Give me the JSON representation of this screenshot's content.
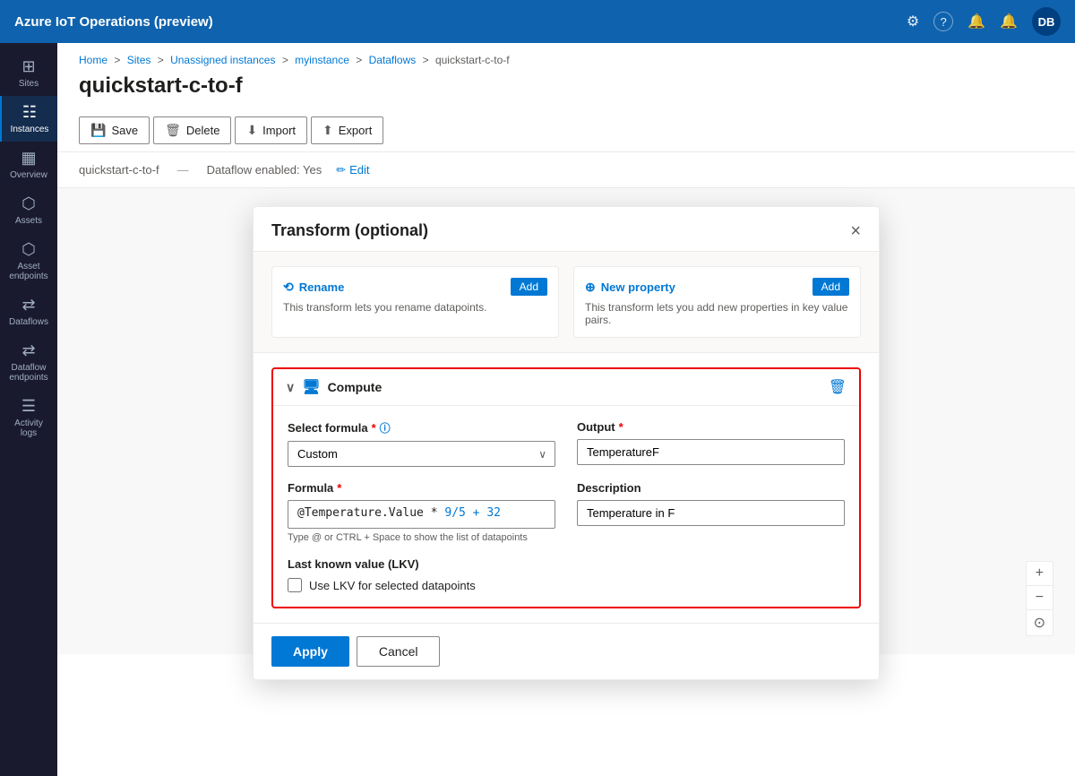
{
  "app": {
    "title": "Azure IoT Operations (preview)"
  },
  "topbar": {
    "title": "Azure IoT Operations (preview)",
    "icons": {
      "settings": "⚙",
      "help": "?",
      "notifications_bell": "🔔",
      "alert_bell": "🔔",
      "avatar_initials": "DB"
    }
  },
  "sidebar": {
    "items": [
      {
        "id": "sites",
        "label": "Sites",
        "icon": "⊞"
      },
      {
        "id": "instances",
        "label": "Instances",
        "icon": "☷",
        "active": true
      },
      {
        "id": "overview",
        "label": "Overview",
        "icon": "▦"
      },
      {
        "id": "assets",
        "label": "Assets",
        "icon": "⬡"
      },
      {
        "id": "asset-endpoints",
        "label": "Asset endpoints",
        "icon": "⬡"
      },
      {
        "id": "dataflows",
        "label": "Dataflows",
        "icon": "⇄"
      },
      {
        "id": "dataflow-endpoints",
        "label": "Dataflow endpoints",
        "icon": "⇄"
      },
      {
        "id": "activity-logs",
        "label": "Activity logs",
        "icon": "☰"
      }
    ]
  },
  "breadcrumb": {
    "parts": [
      {
        "label": "Home",
        "link": true
      },
      {
        "label": "Sites",
        "link": true
      },
      {
        "label": "Unassigned instances",
        "link": true
      },
      {
        "label": "myinstance",
        "link": true
      },
      {
        "label": "Dataflows",
        "link": true
      },
      {
        "label": "quickstart-c-to-f",
        "link": false
      }
    ]
  },
  "page": {
    "title": "quickstart-c-to-f"
  },
  "toolbar": {
    "buttons": [
      {
        "id": "save",
        "label": "Save",
        "icon": "💾"
      },
      {
        "id": "delete",
        "label": "Delete",
        "icon": "🗑"
      },
      {
        "id": "import",
        "label": "Import",
        "icon": "⬇"
      },
      {
        "id": "export",
        "label": "Export",
        "icon": "⬆"
      }
    ]
  },
  "tab_bar": {
    "name": "quickstart-c-to-f",
    "dataflow_label": "Dataflow enabled: Yes",
    "edit_label": "Edit"
  },
  "modal": {
    "title": "Transform (optional)",
    "close_label": "×",
    "transform_cards": [
      {
        "title": "Rename",
        "add_label": "Add",
        "description": "This transform lets you rename datapoints."
      },
      {
        "title": "New property",
        "add_label": "Add",
        "description": "This transform lets you add new properties in key value pairs."
      }
    ],
    "compute_section": {
      "title": "Compute",
      "icon": "🖥",
      "select_formula_label": "Select formula",
      "select_formula_required": true,
      "select_formula_info": true,
      "formula_options": [
        {
          "value": "Custom",
          "label": "Custom"
        }
      ],
      "formula_value": "@Temperature.Value * 9/5 + 32",
      "output_label": "Output",
      "output_required": true,
      "output_value": "TemperatureF",
      "formula_label": "Formula",
      "formula_required": true,
      "formula_hint": "Type @ or CTRL + Space to show the list of datapoints",
      "description_label": "Description",
      "description_value": "Temperature in F",
      "lkv_section_label": "Last known value (LKV)",
      "lkv_checkbox_label": "Use LKV for selected datapoints",
      "lkv_checked": false
    },
    "footer": {
      "apply_label": "Apply",
      "cancel_label": "Cancel"
    }
  },
  "zoom_controls": {
    "plus_label": "+",
    "minus_label": "−",
    "reset_label": "⊙"
  }
}
